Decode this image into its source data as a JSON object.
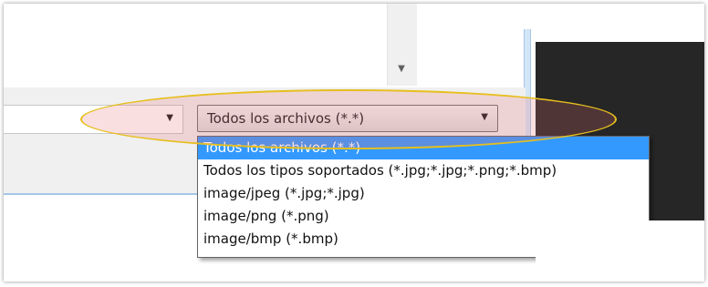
{
  "left_combo": {
    "value": ""
  },
  "file_type_filter": {
    "selected": "Todos los archivos (*.*)",
    "options": [
      "Todos los archivos (*.*)",
      "Todos los tipos soportados (*.jpg;*.jpg;*.png;*.bmp)",
      "image/jpeg (*.jpg;*.jpg)",
      "image/png (*.png)",
      "image/bmp (*.bmp)"
    ],
    "highlighted_index": 0
  },
  "colors": {
    "selection": "#3399ff",
    "annotation_ellipse": "#e6bf1e",
    "preview_panel": "#262626"
  },
  "icons": {
    "combo_arrow": "chevron-down-icon",
    "scroll_arrow": "scroll-down-icon"
  }
}
